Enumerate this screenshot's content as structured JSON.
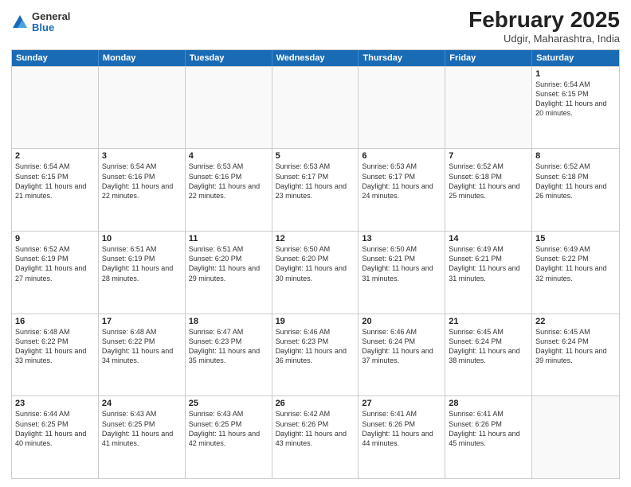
{
  "logo": {
    "general": "General",
    "blue": "Blue"
  },
  "header": {
    "month": "February 2025",
    "location": "Udgir, Maharashtra, India"
  },
  "weekdays": [
    "Sunday",
    "Monday",
    "Tuesday",
    "Wednesday",
    "Thursday",
    "Friday",
    "Saturday"
  ],
  "rows": [
    [
      {
        "day": "",
        "info": ""
      },
      {
        "day": "",
        "info": ""
      },
      {
        "day": "",
        "info": ""
      },
      {
        "day": "",
        "info": ""
      },
      {
        "day": "",
        "info": ""
      },
      {
        "day": "",
        "info": ""
      },
      {
        "day": "1",
        "info": "Sunrise: 6:54 AM\nSunset: 6:15 PM\nDaylight: 11 hours and 20 minutes."
      }
    ],
    [
      {
        "day": "2",
        "info": "Sunrise: 6:54 AM\nSunset: 6:15 PM\nDaylight: 11 hours and 21 minutes."
      },
      {
        "day": "3",
        "info": "Sunrise: 6:54 AM\nSunset: 6:16 PM\nDaylight: 11 hours and 22 minutes."
      },
      {
        "day": "4",
        "info": "Sunrise: 6:53 AM\nSunset: 6:16 PM\nDaylight: 11 hours and 22 minutes."
      },
      {
        "day": "5",
        "info": "Sunrise: 6:53 AM\nSunset: 6:17 PM\nDaylight: 11 hours and 23 minutes."
      },
      {
        "day": "6",
        "info": "Sunrise: 6:53 AM\nSunset: 6:17 PM\nDaylight: 11 hours and 24 minutes."
      },
      {
        "day": "7",
        "info": "Sunrise: 6:52 AM\nSunset: 6:18 PM\nDaylight: 11 hours and 25 minutes."
      },
      {
        "day": "8",
        "info": "Sunrise: 6:52 AM\nSunset: 6:18 PM\nDaylight: 11 hours and 26 minutes."
      }
    ],
    [
      {
        "day": "9",
        "info": "Sunrise: 6:52 AM\nSunset: 6:19 PM\nDaylight: 11 hours and 27 minutes."
      },
      {
        "day": "10",
        "info": "Sunrise: 6:51 AM\nSunset: 6:19 PM\nDaylight: 11 hours and 28 minutes."
      },
      {
        "day": "11",
        "info": "Sunrise: 6:51 AM\nSunset: 6:20 PM\nDaylight: 11 hours and 29 minutes."
      },
      {
        "day": "12",
        "info": "Sunrise: 6:50 AM\nSunset: 6:20 PM\nDaylight: 11 hours and 30 minutes."
      },
      {
        "day": "13",
        "info": "Sunrise: 6:50 AM\nSunset: 6:21 PM\nDaylight: 11 hours and 31 minutes."
      },
      {
        "day": "14",
        "info": "Sunrise: 6:49 AM\nSunset: 6:21 PM\nDaylight: 11 hours and 31 minutes."
      },
      {
        "day": "15",
        "info": "Sunrise: 6:49 AM\nSunset: 6:22 PM\nDaylight: 11 hours and 32 minutes."
      }
    ],
    [
      {
        "day": "16",
        "info": "Sunrise: 6:48 AM\nSunset: 6:22 PM\nDaylight: 11 hours and 33 minutes."
      },
      {
        "day": "17",
        "info": "Sunrise: 6:48 AM\nSunset: 6:22 PM\nDaylight: 11 hours and 34 minutes."
      },
      {
        "day": "18",
        "info": "Sunrise: 6:47 AM\nSunset: 6:23 PM\nDaylight: 11 hours and 35 minutes."
      },
      {
        "day": "19",
        "info": "Sunrise: 6:46 AM\nSunset: 6:23 PM\nDaylight: 11 hours and 36 minutes."
      },
      {
        "day": "20",
        "info": "Sunrise: 6:46 AM\nSunset: 6:24 PM\nDaylight: 11 hours and 37 minutes."
      },
      {
        "day": "21",
        "info": "Sunrise: 6:45 AM\nSunset: 6:24 PM\nDaylight: 11 hours and 38 minutes."
      },
      {
        "day": "22",
        "info": "Sunrise: 6:45 AM\nSunset: 6:24 PM\nDaylight: 11 hours and 39 minutes."
      }
    ],
    [
      {
        "day": "23",
        "info": "Sunrise: 6:44 AM\nSunset: 6:25 PM\nDaylight: 11 hours and 40 minutes."
      },
      {
        "day": "24",
        "info": "Sunrise: 6:43 AM\nSunset: 6:25 PM\nDaylight: 11 hours and 41 minutes."
      },
      {
        "day": "25",
        "info": "Sunrise: 6:43 AM\nSunset: 6:25 PM\nDaylight: 11 hours and 42 minutes."
      },
      {
        "day": "26",
        "info": "Sunrise: 6:42 AM\nSunset: 6:26 PM\nDaylight: 11 hours and 43 minutes."
      },
      {
        "day": "27",
        "info": "Sunrise: 6:41 AM\nSunset: 6:26 PM\nDaylight: 11 hours and 44 minutes."
      },
      {
        "day": "28",
        "info": "Sunrise: 6:41 AM\nSunset: 6:26 PM\nDaylight: 11 hours and 45 minutes."
      },
      {
        "day": "",
        "info": ""
      }
    ]
  ]
}
